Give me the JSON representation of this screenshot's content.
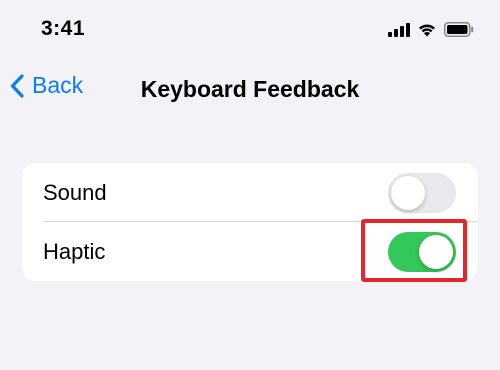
{
  "status_bar": {
    "time": "3:41",
    "icons": [
      "cellular-signal-icon",
      "wifi-icon",
      "battery-icon"
    ]
  },
  "nav": {
    "back_label": "Back",
    "title": "Keyboard Feedback"
  },
  "settings": {
    "rows": [
      {
        "label": "Sound",
        "toggle": false
      },
      {
        "label": "Haptic",
        "toggle": true
      }
    ]
  },
  "colors": {
    "accent": "#0a7aff",
    "toggle_on": "#34c759",
    "toggle_off": "#e9e9eb",
    "background": "#f2f2f7",
    "highlight": "#e3262b"
  }
}
